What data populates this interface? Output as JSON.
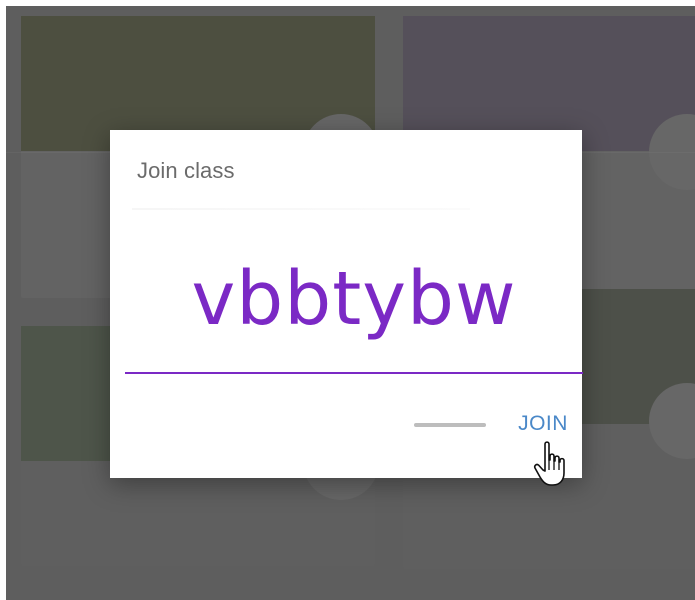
{
  "dialog": {
    "title": "Join class",
    "class_code": "vbbtybw",
    "join_label": "JOIN",
    "cancel_icon": "blurred-cancel-button"
  },
  "background": {
    "cards": [
      "class-card",
      "class-card",
      "class-card",
      "class-card"
    ]
  },
  "colors": {
    "accent": "#7b29c5",
    "join": "#4a88c8",
    "scrim": "#5e5e5e"
  },
  "icons": {
    "cursor": "hand-pointer-icon"
  }
}
